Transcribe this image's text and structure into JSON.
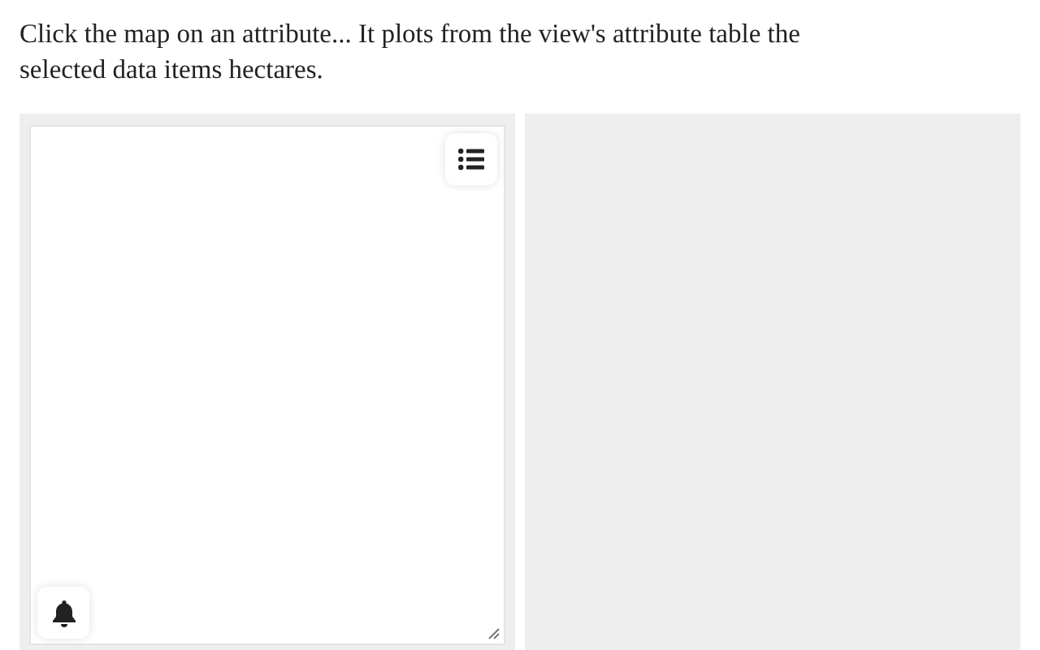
{
  "intro": "Click the map on an attribute... It plots from the view's attribute table the selected data items hectares."
}
